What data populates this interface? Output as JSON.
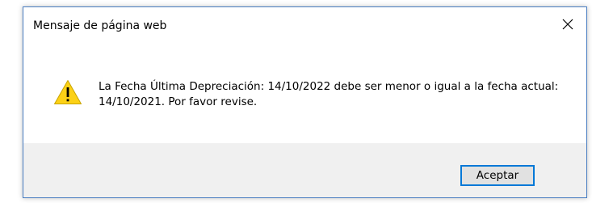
{
  "window": {
    "title": "Mensaje de página web",
    "close_icon": "close-icon"
  },
  "message": {
    "icon": "warning-icon",
    "text": "La Fecha Última Depreciación: 14/10/2022 debe ser menor o igual a la fecha actual: 14/10/2021. Por favor revise."
  },
  "footer": {
    "ok_label": "Aceptar"
  },
  "colors": {
    "accent": "#0078d7",
    "border": "#4a7ec2",
    "footer_bg": "#f0f0f0",
    "warning_fill": "#fcd116"
  }
}
